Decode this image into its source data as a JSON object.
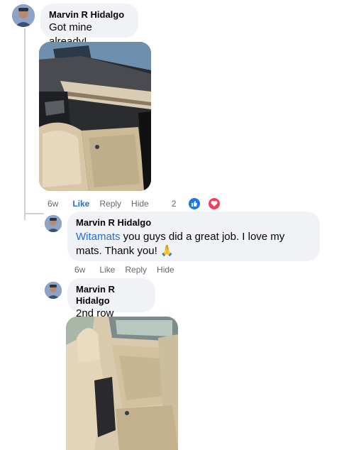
{
  "comments": [
    {
      "author": "Marvin R Hidalgo",
      "text": "Got mine already!",
      "age": "6w",
      "like": "Like",
      "reply": "Reply",
      "hide": "Hide",
      "reaction_count": "2",
      "reactions": [
        "like-icon",
        "love-icon"
      ],
      "has_photo": true,
      "photo_desc_icon": "car-interior-photo"
    },
    {
      "author": "Marvin R Hidalgo",
      "mention": "Witamats",
      "text": " you guys did a great job. I love my mats. Thank you! 🙏",
      "age": "6w",
      "like": "Like",
      "reply": "Reply",
      "hide": "Hide"
    },
    {
      "author": "Marvin R Hidalgo",
      "text": "2nd row",
      "has_photo": true,
      "photo_desc_icon": "car-rear-seat-photo"
    }
  ],
  "colors": {
    "bubble": "#f0f2f5",
    "link_blue": "#216fdb",
    "meta_gray": "#65676b",
    "love_red": "#f33e58"
  }
}
